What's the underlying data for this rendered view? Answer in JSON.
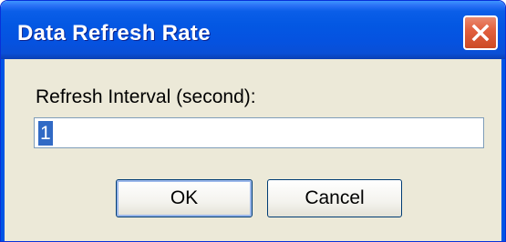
{
  "window": {
    "title": "Data Refresh Rate",
    "close_label": "close"
  },
  "form": {
    "label": "Refresh Interval (second):",
    "value": "1"
  },
  "buttons": {
    "ok": "OK",
    "cancel": "Cancel"
  },
  "colors": {
    "titlebar": "#0458e3",
    "close": "#e2603f",
    "dialog_bg": "#ece9d8",
    "selection": "#316ac5"
  },
  "icons": {
    "close": "close-icon"
  }
}
